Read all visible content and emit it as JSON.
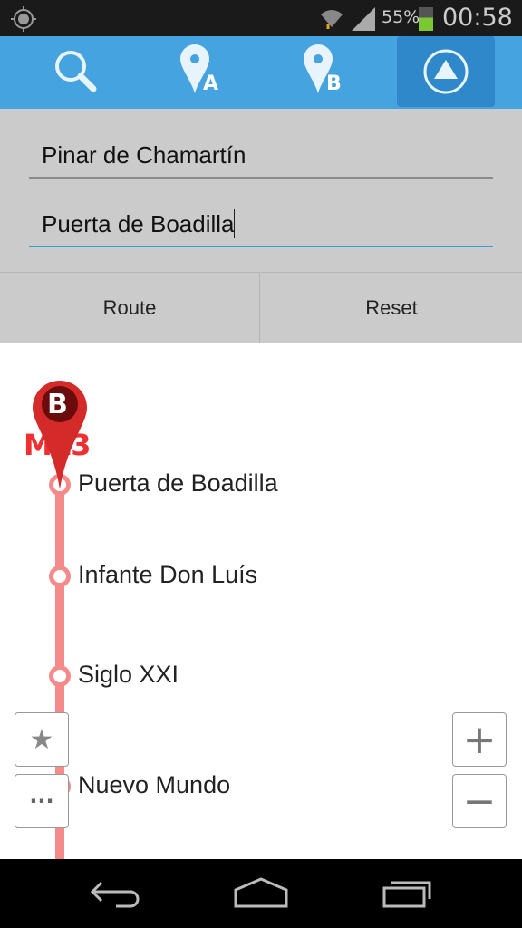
{
  "status_bar": {
    "battery": "55%",
    "time": "00:58",
    "icons": [
      "gps-icon",
      "wifi-icon",
      "signal-icon",
      "battery-charging-icon"
    ]
  },
  "toolbar": {
    "items": [
      {
        "name": "search-icon"
      },
      {
        "name": "origin-pin-icon",
        "label": "A"
      },
      {
        "name": "destination-pin-icon",
        "label": "B"
      },
      {
        "name": "route-up-icon",
        "active": true
      }
    ],
    "accent": "#45a3e0"
  },
  "form": {
    "origin": "Pinar de  Chamartín",
    "destination": "Puerta de Boadilla",
    "route_label": "Route",
    "reset_label": "Reset"
  },
  "map": {
    "line_label": "ML3",
    "pin_label": "B",
    "line_color": "#f58a8a",
    "stations": [
      "Puerta de Boadilla",
      "Infante Don Luís",
      "Siglo XXI",
      "Nuevo Mundo"
    ],
    "zoom_in": "+",
    "zoom_out": "−",
    "more": "···"
  }
}
